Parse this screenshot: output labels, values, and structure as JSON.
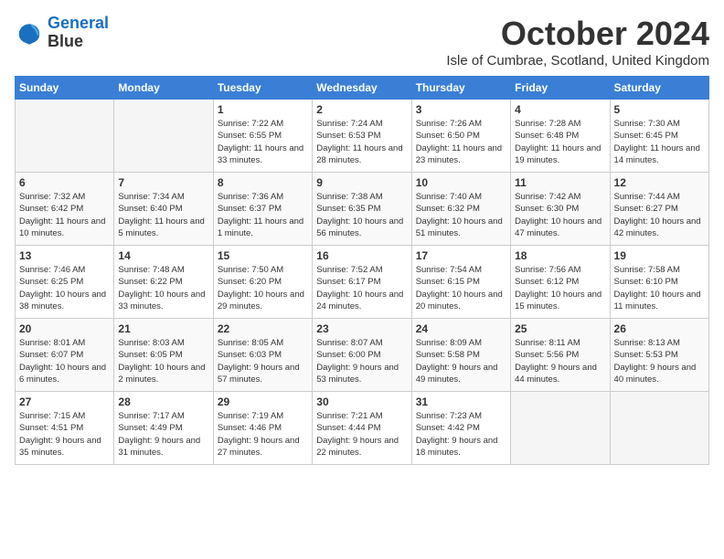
{
  "logo": {
    "line1": "General",
    "line2": "Blue"
  },
  "title": "October 2024",
  "location": "Isle of Cumbrae, Scotland, United Kingdom",
  "days_of_week": [
    "Sunday",
    "Monday",
    "Tuesday",
    "Wednesday",
    "Thursday",
    "Friday",
    "Saturday"
  ],
  "weeks": [
    [
      {
        "day": null,
        "sunrise": null,
        "sunset": null,
        "daylight": null
      },
      {
        "day": null,
        "sunrise": null,
        "sunset": null,
        "daylight": null
      },
      {
        "day": "1",
        "sunrise": "Sunrise: 7:22 AM",
        "sunset": "Sunset: 6:55 PM",
        "daylight": "Daylight: 11 hours and 33 minutes."
      },
      {
        "day": "2",
        "sunrise": "Sunrise: 7:24 AM",
        "sunset": "Sunset: 6:53 PM",
        "daylight": "Daylight: 11 hours and 28 minutes."
      },
      {
        "day": "3",
        "sunrise": "Sunrise: 7:26 AM",
        "sunset": "Sunset: 6:50 PM",
        "daylight": "Daylight: 11 hours and 23 minutes."
      },
      {
        "day": "4",
        "sunrise": "Sunrise: 7:28 AM",
        "sunset": "Sunset: 6:48 PM",
        "daylight": "Daylight: 11 hours and 19 minutes."
      },
      {
        "day": "5",
        "sunrise": "Sunrise: 7:30 AM",
        "sunset": "Sunset: 6:45 PM",
        "daylight": "Daylight: 11 hours and 14 minutes."
      }
    ],
    [
      {
        "day": "6",
        "sunrise": "Sunrise: 7:32 AM",
        "sunset": "Sunset: 6:42 PM",
        "daylight": "Daylight: 11 hours and 10 minutes."
      },
      {
        "day": "7",
        "sunrise": "Sunrise: 7:34 AM",
        "sunset": "Sunset: 6:40 PM",
        "daylight": "Daylight: 11 hours and 5 minutes."
      },
      {
        "day": "8",
        "sunrise": "Sunrise: 7:36 AM",
        "sunset": "Sunset: 6:37 PM",
        "daylight": "Daylight: 11 hours and 1 minute."
      },
      {
        "day": "9",
        "sunrise": "Sunrise: 7:38 AM",
        "sunset": "Sunset: 6:35 PM",
        "daylight": "Daylight: 10 hours and 56 minutes."
      },
      {
        "day": "10",
        "sunrise": "Sunrise: 7:40 AM",
        "sunset": "Sunset: 6:32 PM",
        "daylight": "Daylight: 10 hours and 51 minutes."
      },
      {
        "day": "11",
        "sunrise": "Sunrise: 7:42 AM",
        "sunset": "Sunset: 6:30 PM",
        "daylight": "Daylight: 10 hours and 47 minutes."
      },
      {
        "day": "12",
        "sunrise": "Sunrise: 7:44 AM",
        "sunset": "Sunset: 6:27 PM",
        "daylight": "Daylight: 10 hours and 42 minutes."
      }
    ],
    [
      {
        "day": "13",
        "sunrise": "Sunrise: 7:46 AM",
        "sunset": "Sunset: 6:25 PM",
        "daylight": "Daylight: 10 hours and 38 minutes."
      },
      {
        "day": "14",
        "sunrise": "Sunrise: 7:48 AM",
        "sunset": "Sunset: 6:22 PM",
        "daylight": "Daylight: 10 hours and 33 minutes."
      },
      {
        "day": "15",
        "sunrise": "Sunrise: 7:50 AM",
        "sunset": "Sunset: 6:20 PM",
        "daylight": "Daylight: 10 hours and 29 minutes."
      },
      {
        "day": "16",
        "sunrise": "Sunrise: 7:52 AM",
        "sunset": "Sunset: 6:17 PM",
        "daylight": "Daylight: 10 hours and 24 minutes."
      },
      {
        "day": "17",
        "sunrise": "Sunrise: 7:54 AM",
        "sunset": "Sunset: 6:15 PM",
        "daylight": "Daylight: 10 hours and 20 minutes."
      },
      {
        "day": "18",
        "sunrise": "Sunrise: 7:56 AM",
        "sunset": "Sunset: 6:12 PM",
        "daylight": "Daylight: 10 hours and 15 minutes."
      },
      {
        "day": "19",
        "sunrise": "Sunrise: 7:58 AM",
        "sunset": "Sunset: 6:10 PM",
        "daylight": "Daylight: 10 hours and 11 minutes."
      }
    ],
    [
      {
        "day": "20",
        "sunrise": "Sunrise: 8:01 AM",
        "sunset": "Sunset: 6:07 PM",
        "daylight": "Daylight: 10 hours and 6 minutes."
      },
      {
        "day": "21",
        "sunrise": "Sunrise: 8:03 AM",
        "sunset": "Sunset: 6:05 PM",
        "daylight": "Daylight: 10 hours and 2 minutes."
      },
      {
        "day": "22",
        "sunrise": "Sunrise: 8:05 AM",
        "sunset": "Sunset: 6:03 PM",
        "daylight": "Daylight: 9 hours and 57 minutes."
      },
      {
        "day": "23",
        "sunrise": "Sunrise: 8:07 AM",
        "sunset": "Sunset: 6:00 PM",
        "daylight": "Daylight: 9 hours and 53 minutes."
      },
      {
        "day": "24",
        "sunrise": "Sunrise: 8:09 AM",
        "sunset": "Sunset: 5:58 PM",
        "daylight": "Daylight: 9 hours and 49 minutes."
      },
      {
        "day": "25",
        "sunrise": "Sunrise: 8:11 AM",
        "sunset": "Sunset: 5:56 PM",
        "daylight": "Daylight: 9 hours and 44 minutes."
      },
      {
        "day": "26",
        "sunrise": "Sunrise: 8:13 AM",
        "sunset": "Sunset: 5:53 PM",
        "daylight": "Daylight: 9 hours and 40 minutes."
      }
    ],
    [
      {
        "day": "27",
        "sunrise": "Sunrise: 7:15 AM",
        "sunset": "Sunset: 4:51 PM",
        "daylight": "Daylight: 9 hours and 35 minutes."
      },
      {
        "day": "28",
        "sunrise": "Sunrise: 7:17 AM",
        "sunset": "Sunset: 4:49 PM",
        "daylight": "Daylight: 9 hours and 31 minutes."
      },
      {
        "day": "29",
        "sunrise": "Sunrise: 7:19 AM",
        "sunset": "Sunset: 4:46 PM",
        "daylight": "Daylight: 9 hours and 27 minutes."
      },
      {
        "day": "30",
        "sunrise": "Sunrise: 7:21 AM",
        "sunset": "Sunset: 4:44 PM",
        "daylight": "Daylight: 9 hours and 22 minutes."
      },
      {
        "day": "31",
        "sunrise": "Sunrise: 7:23 AM",
        "sunset": "Sunset: 4:42 PM",
        "daylight": "Daylight: 9 hours and 18 minutes."
      },
      {
        "day": null,
        "sunrise": null,
        "sunset": null,
        "daylight": null
      },
      {
        "day": null,
        "sunrise": null,
        "sunset": null,
        "daylight": null
      }
    ]
  ]
}
